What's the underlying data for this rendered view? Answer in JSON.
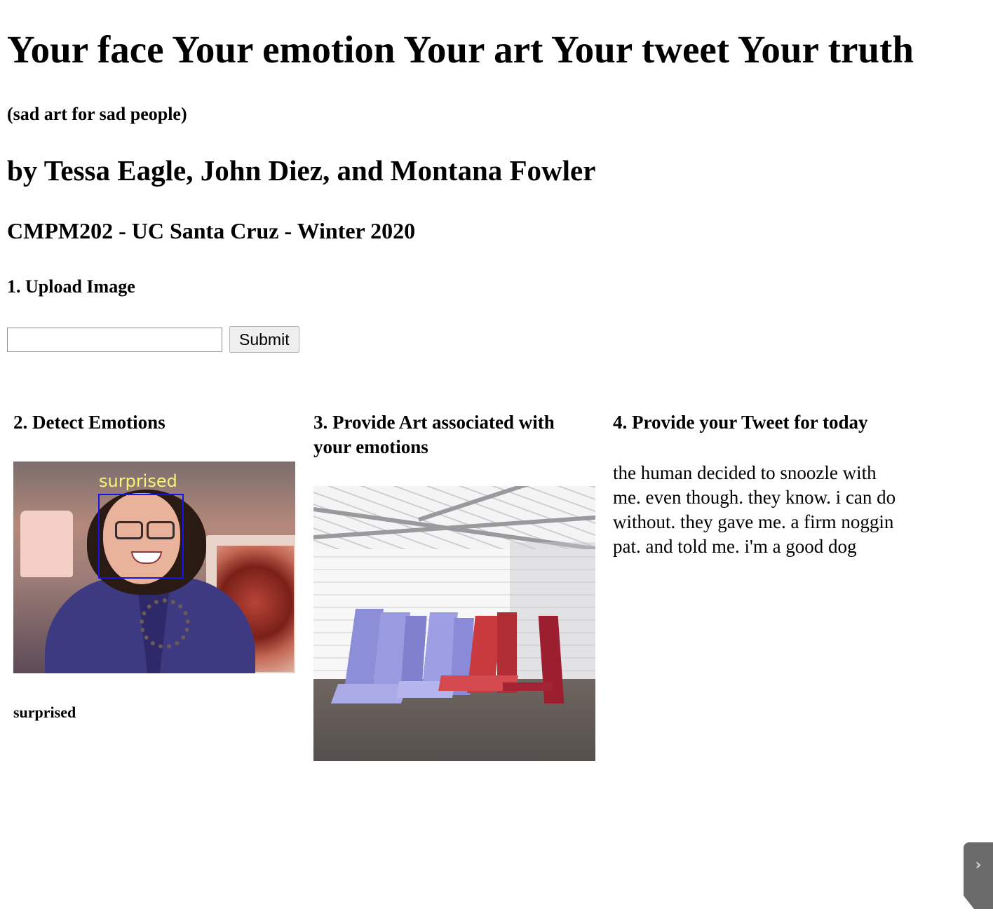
{
  "header": {
    "title": "Your face Your emotion Your art Your tweet Your truth",
    "subtitle": "(sad art for sad people)",
    "authors": "by Tessa Eagle, John Diez, and Montana Fowler",
    "course": "CMPM202 - UC Santa Cruz - Winter 2020"
  },
  "upload": {
    "heading": "1. Upload Image",
    "input_value": "",
    "submit_label": "Submit"
  },
  "detect": {
    "heading": "2. Detect Emotions",
    "overlay_label": "surprised",
    "result": "surprised"
  },
  "art": {
    "heading": "3. Provide Art associated with your emotions"
  },
  "tweet": {
    "heading": "4. Provide your Tweet for today",
    "text": "the human decided to snoozle with me. even though. they know. i can do without. they gave me. a firm noggin pat. and told me. i'm a good dog"
  },
  "side_tab": {
    "icon": "chevron-right-icon"
  }
}
